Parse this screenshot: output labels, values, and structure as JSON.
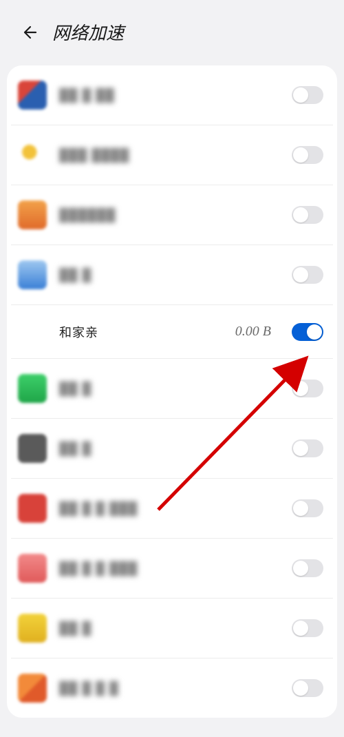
{
  "header": {
    "title": "网络加速"
  },
  "featured": {
    "label": "和家亲",
    "data": "0.00 B",
    "on": true
  },
  "apps": [
    {
      "label": "██ █ ██",
      "icon": "ic-a",
      "on": false
    },
    {
      "label": "███ ████",
      "icon": "ic-b",
      "on": false
    },
    {
      "label": "██████",
      "icon": "ic-c",
      "on": false
    },
    {
      "label": "██ █",
      "icon": "ic-d",
      "on": false
    },
    {
      "featured": true
    },
    {
      "label": "██ █",
      "icon": "ic-f",
      "on": false
    },
    {
      "label": "██ █",
      "icon": "ic-g",
      "on": false
    },
    {
      "label": "██ █ █ ███",
      "icon": "ic-h",
      "on": false
    },
    {
      "label": "██ █ █ ███",
      "icon": "ic-i",
      "on": false
    },
    {
      "label": "██ █",
      "icon": "ic-j",
      "on": false
    },
    {
      "label": "██ █ █ █",
      "icon": "ic-k",
      "on": false
    }
  ]
}
